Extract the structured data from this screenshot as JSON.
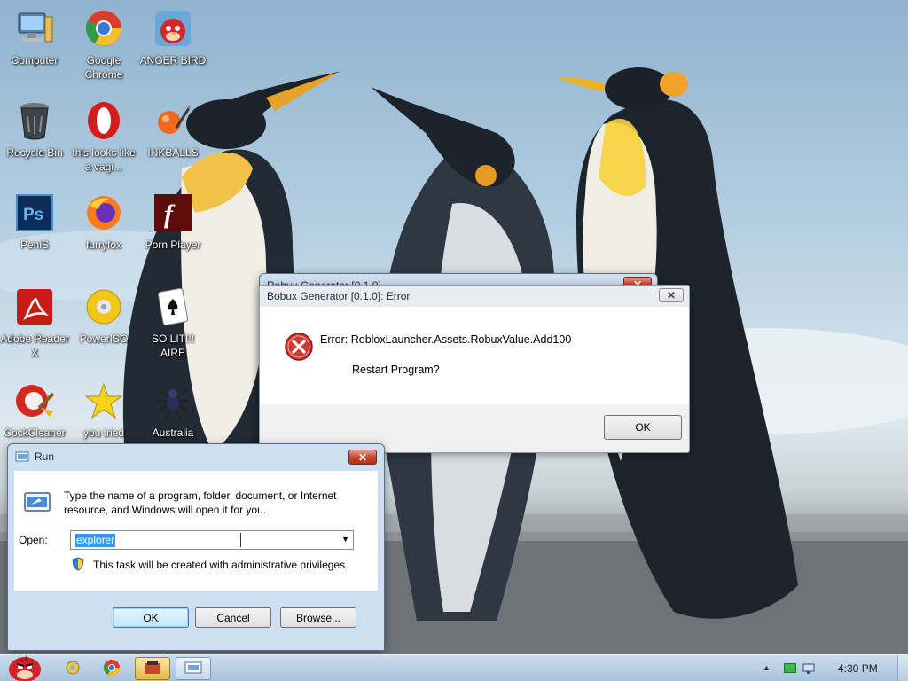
{
  "desktop": {
    "icons": [
      {
        "label": "Computer",
        "icon": "computer-icon"
      },
      {
        "label": "Google Chrome",
        "icon": "chrome-icon"
      },
      {
        "label": "ANGER BIRD",
        "icon": "angry-bird-icon"
      },
      {
        "label": "Recycle Bin",
        "icon": "recycle-bin-icon"
      },
      {
        "label": "this looks like a vagi...",
        "icon": "opera-icon"
      },
      {
        "label": "INKBALLS",
        "icon": "inkball-icon"
      },
      {
        "label": "PeniS",
        "icon": "photoshop-icon"
      },
      {
        "label": "furryfox",
        "icon": "firefox-icon"
      },
      {
        "label": "Porn Player",
        "icon": "flash-player-icon"
      },
      {
        "label": "Adobe Reader X",
        "icon": "adobe-reader-icon"
      },
      {
        "label": "PowerISO",
        "icon": "poweriso-icon"
      },
      {
        "label": "SO LIT!!! AIRE",
        "icon": "solitaire-icon"
      },
      {
        "label": "CockCleaner",
        "icon": "ccleaner-icon"
      },
      {
        "label": "you tried",
        "icon": "star-icon"
      },
      {
        "label": "Australia",
        "icon": "spider-icon"
      }
    ]
  },
  "back_dialog": {
    "title": "Robux Generator [0.1.0]"
  },
  "error_dialog": {
    "title": "Bobux Generator [0.1.0]: Error",
    "message": "Error: RobloxLauncher.Assets.RobuxValue.Add100",
    "question": "Restart Program?",
    "ok_label": "OK"
  },
  "run_dialog": {
    "title": "Run",
    "description": "Type the name of a program, folder, document, or Internet resource, and Windows will open it for you.",
    "open_label": "Open:",
    "input_value": "explorer",
    "admin_note": "This task will be created with administrative privileges.",
    "ok_label": "OK",
    "cancel_label": "Cancel",
    "browse_label": "Browse..."
  },
  "taskbar": {
    "time": "4:30 PM",
    "items": [
      "start-orb-icon",
      "folder-icon",
      "chrome-icon",
      "error-app-icon",
      "run-icon"
    ]
  },
  "colors": {
    "selection": "#3399ff",
    "titlebar": "#cfdff0",
    "close_red": "#c8452e"
  }
}
